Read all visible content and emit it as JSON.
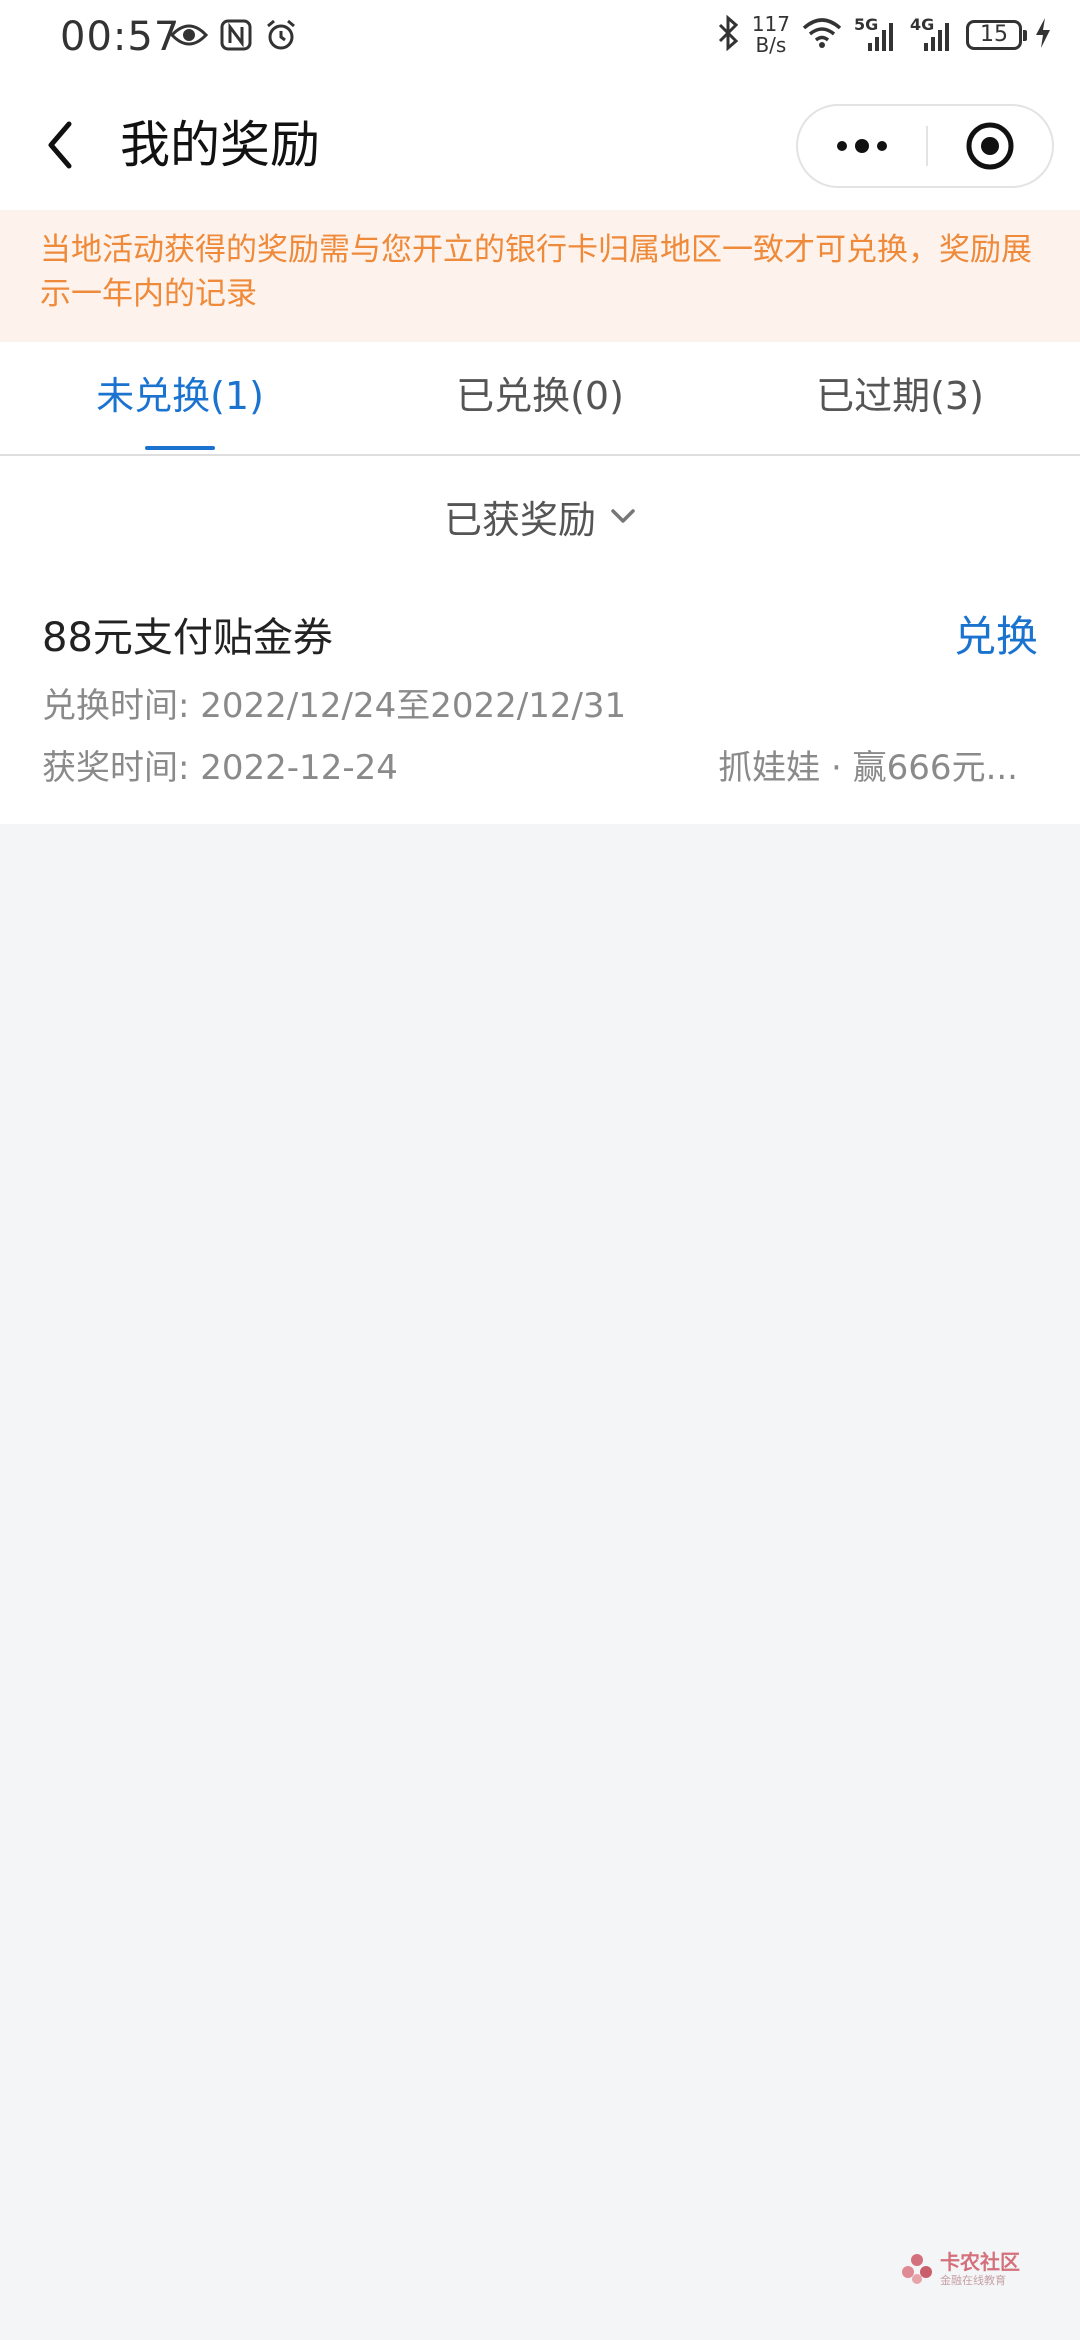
{
  "status_bar": {
    "time": "00:57",
    "net_speed_value": "117",
    "net_speed_unit": "B/s",
    "net_5g": "5G",
    "net_4g": "4G",
    "battery": "15"
  },
  "header": {
    "title": "我的奖励"
  },
  "notice": {
    "text": "当地活动获得的奖励需与您开立的银行卡归属地区一致才可兑换，奖励展示一年内的记录"
  },
  "tabs": [
    {
      "label": "未兑换(1)",
      "active": true
    },
    {
      "label": "已兑换(0)",
      "active": false
    },
    {
      "label": "已过期(3)",
      "active": false
    }
  ],
  "filter": {
    "label": "已获奖励"
  },
  "rewards": [
    {
      "name": "88元支付贴金券",
      "action": "兑换",
      "redeem_time": "兑换时间: 2022/12/24至2022/12/31",
      "award_time": "获奖时间: 2022-12-24",
      "activity": "抓娃娃 · 赢666元..."
    }
  ],
  "watermark": {
    "main": "卡农社区",
    "sub": "金融在线教育"
  },
  "colors": {
    "accent": "#1b73d0",
    "notice_text": "#ef8a3a",
    "notice_bg": "#fef3ec",
    "page_bg": "#f4f5f7"
  }
}
